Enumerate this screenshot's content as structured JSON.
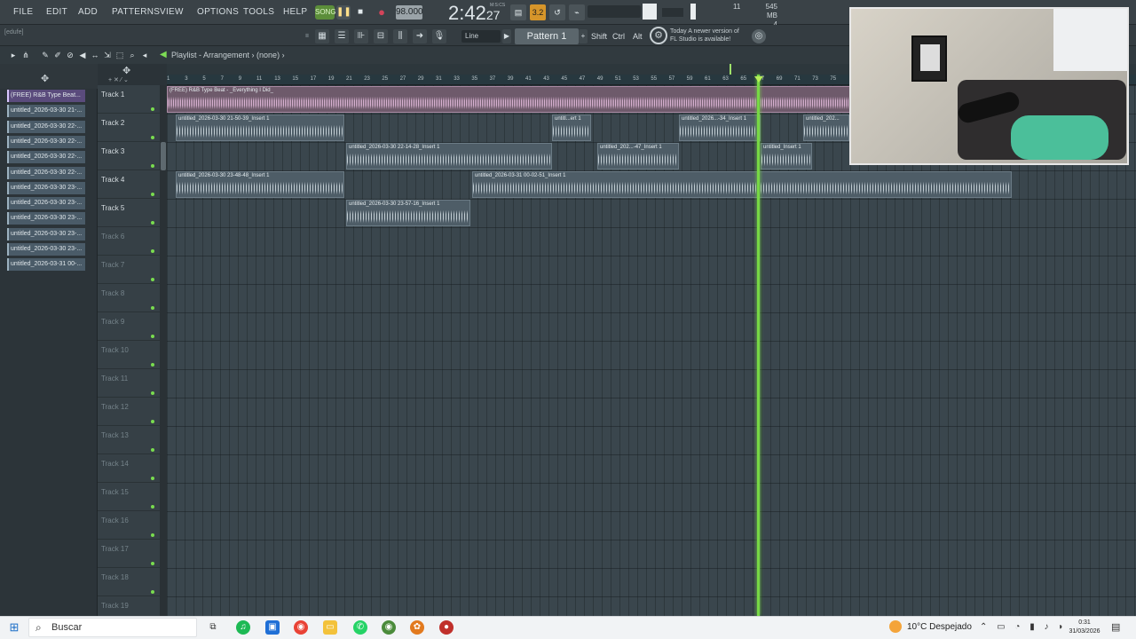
{
  "menu": [
    "FILE",
    "EDIT",
    "ADD",
    "PATTERNS",
    "VIEW",
    "OPTIONS",
    "TOOLS",
    "HELP"
  ],
  "transport": {
    "mode_label": "SONG",
    "tempo": "98.000",
    "time_main": "2:42",
    "time_sub": "27",
    "time_unit": "M:S:CS",
    "cpu": "11",
    "memory": "545 MB",
    "poly": "4",
    "meter_label": "3.2"
  },
  "toolbar2": {
    "hint": "[edufe]",
    "snap": "Line",
    "pattern": "Pattern 1",
    "keys": [
      "Shift",
      "Ctrl",
      "Alt"
    ],
    "news_line1": "Today  A newer version of",
    "news_line2": "FL Studio is available!"
  },
  "playlist": {
    "title": "Playlist - Arrangement",
    "arrangement": "(none)",
    "ruler": [
      "1",
      "3",
      "5",
      "7",
      "9",
      "11",
      "13",
      "15",
      "17",
      "19",
      "21",
      "23",
      "25",
      "27",
      "29",
      "31",
      "33",
      "35",
      "37",
      "39",
      "41",
      "43",
      "45",
      "47",
      "49",
      "51",
      "53",
      "55",
      "57",
      "59",
      "61",
      "63",
      "65",
      "67",
      "69",
      "71",
      "73",
      "75"
    ],
    "tracks": [
      "Track 1",
      "Track 2",
      "Track 3",
      "Track 4",
      "Track 5",
      "Track 6",
      "Track 7",
      "Track 8",
      "Track 9",
      "Track 10",
      "Track 11",
      "Track 12",
      "Track 13",
      "Track 14",
      "Track 15",
      "Track 16",
      "Track 17",
      "Track 18",
      "Track 19"
    ]
  },
  "clip_list": [
    "(FREE) R&B Type Beat...",
    "untitled_2026-03-30 21-...",
    "untitled_2026-03-30 22-...",
    "untitled_2026-03-30 22-...",
    "untitled_2026-03-30 22-...",
    "untitled_2026-03-30 22-...",
    "untitled_2026-03-30 23-...",
    "untitled_2026-03-30 23-...",
    "untitled_2026-03-30 23-...",
    "untitled_2026-03-30 23-...",
    "untitled_2026-03-30 23-...",
    "untitled_2026-03-31 00-..."
  ],
  "clips": [
    {
      "label": "(FREE) R&B Type Beat - _Everything I Did_"
    },
    {
      "label": "untitled_2026-03-30 21-50-39_Insert 1"
    },
    {
      "label": "untitl...ert 1"
    },
    {
      "label": "untitled_2026...-34_Insert 1"
    },
    {
      "label": "untitled_202..."
    },
    {
      "label": "untitled_2026-03-30 22-14-28_Insert 1"
    },
    {
      "label": "untitled_202...-47_Insert 1"
    },
    {
      "label": "untitled_Insert 1"
    },
    {
      "label": "untitled_2026-03-30 23-48-48_Insert 1"
    },
    {
      "label": "untitled_2026-03-31 00-02-51_Insert 1"
    },
    {
      "label": "untitled_2026-03-30 23-57-16_Insert 1"
    }
  ],
  "taskbar": {
    "search": "Buscar",
    "weather": "10°C  Despejado",
    "time": "0:31",
    "date": "31/03/2026"
  },
  "colors": {
    "accent": "#77d845",
    "clip": "#4e5d67",
    "selected_clip": "#5a4b7c"
  }
}
